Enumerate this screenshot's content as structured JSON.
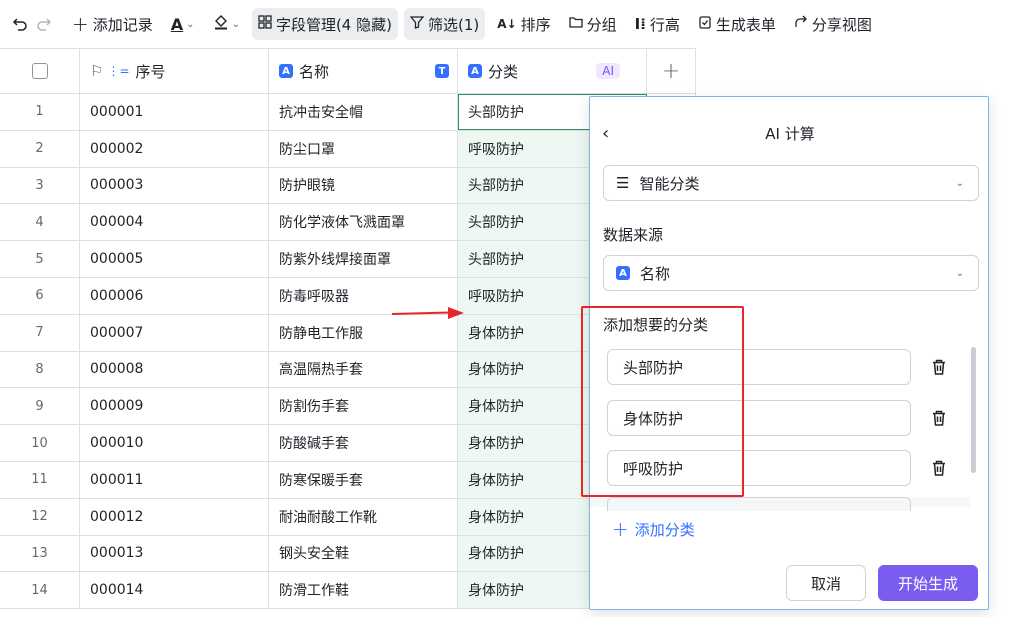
{
  "toolbar": {
    "add_record": "添加记录",
    "field_mgmt": "字段管理(4 隐藏)",
    "filter": "筛选(1)",
    "sort": "排序",
    "group": "分组",
    "row_height": "行高",
    "gen_form": "生成表单",
    "share_view": "分享视图"
  },
  "grid": {
    "columns": [
      "序号",
      "名称",
      "分类"
    ],
    "ai_tag": "AI",
    "rows": [
      {
        "n": "1",
        "id": "000001",
        "name": "抗冲击安全帽",
        "cat": "头部防护"
      },
      {
        "n": "2",
        "id": "000002",
        "name": "防尘口罩",
        "cat": "呼吸防护"
      },
      {
        "n": "3",
        "id": "000003",
        "name": "防护眼镜",
        "cat": "头部防护"
      },
      {
        "n": "4",
        "id": "000004",
        "name": "防化学液体飞溅面罩",
        "cat": "头部防护"
      },
      {
        "n": "5",
        "id": "000005",
        "name": "防紫外线焊接面罩",
        "cat": "头部防护"
      },
      {
        "n": "6",
        "id": "000006",
        "name": "防毒呼吸器",
        "cat": "呼吸防护"
      },
      {
        "n": "7",
        "id": "000007",
        "name": "防静电工作服",
        "cat": "身体防护"
      },
      {
        "n": "8",
        "id": "000008",
        "name": "高温隔热手套",
        "cat": "身体防护"
      },
      {
        "n": "9",
        "id": "000009",
        "name": "防割伤手套",
        "cat": "身体防护"
      },
      {
        "n": "10",
        "id": "000010",
        "name": "防酸碱手套",
        "cat": "身体防护"
      },
      {
        "n": "11",
        "id": "000011",
        "name": "防寒保暖手套",
        "cat": "身体防护"
      },
      {
        "n": "12",
        "id": "000012",
        "name": "耐油耐酸工作靴",
        "cat": "身体防护"
      },
      {
        "n": "13",
        "id": "000013",
        "name": "钢头安全鞋",
        "cat": "身体防护"
      },
      {
        "n": "14",
        "id": "000014",
        "name": "防滑工作鞋",
        "cat": "身体防护"
      }
    ]
  },
  "panel": {
    "title": "AI 计算",
    "mode": "智能分类",
    "source_label": "数据来源",
    "source_value": "名称",
    "categories_label": "添加想要的分类",
    "categories": [
      "头部防护",
      "身体防护",
      "呼吸防护"
    ],
    "add_category": "添加分类",
    "cancel": "取消",
    "start": "开始生成"
  },
  "colors": {
    "accent": "#3370ff",
    "primary_button": "#7b5cf0",
    "highlight_box": "#e5262a",
    "category_cell_bg": "#eef7f2"
  }
}
